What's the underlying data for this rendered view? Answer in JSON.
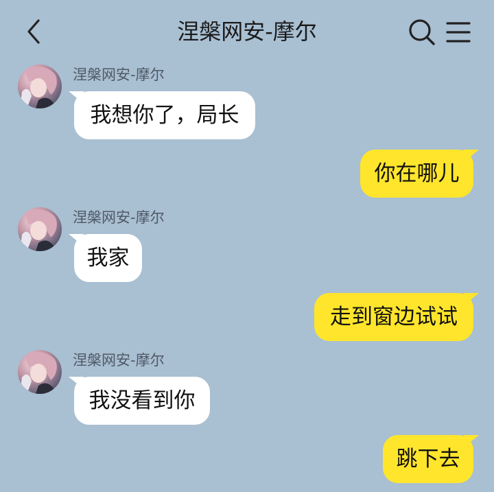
{
  "header": {
    "title": "涅槃网安-摩尔",
    "back_icon": "chevron-left-icon",
    "search_icon": "search-icon",
    "menu_icon": "hamburger-menu-icon"
  },
  "colors": {
    "background": "#a9bfd2",
    "incoming_bubble": "#ffffff",
    "outgoing_bubble": "#ffe52b"
  },
  "messages": [
    {
      "direction": "incoming",
      "sender": "涅槃网安-摩尔",
      "text": "我想你了，局长"
    },
    {
      "direction": "outgoing",
      "text": "你在哪儿"
    },
    {
      "direction": "incoming",
      "sender": "涅槃网安-摩尔",
      "text": "我家"
    },
    {
      "direction": "outgoing",
      "text": "走到窗边试试"
    },
    {
      "direction": "incoming",
      "sender": "涅槃网安-摩尔",
      "text": "我没看到你"
    },
    {
      "direction": "outgoing",
      "text": "跳下去"
    }
  ]
}
